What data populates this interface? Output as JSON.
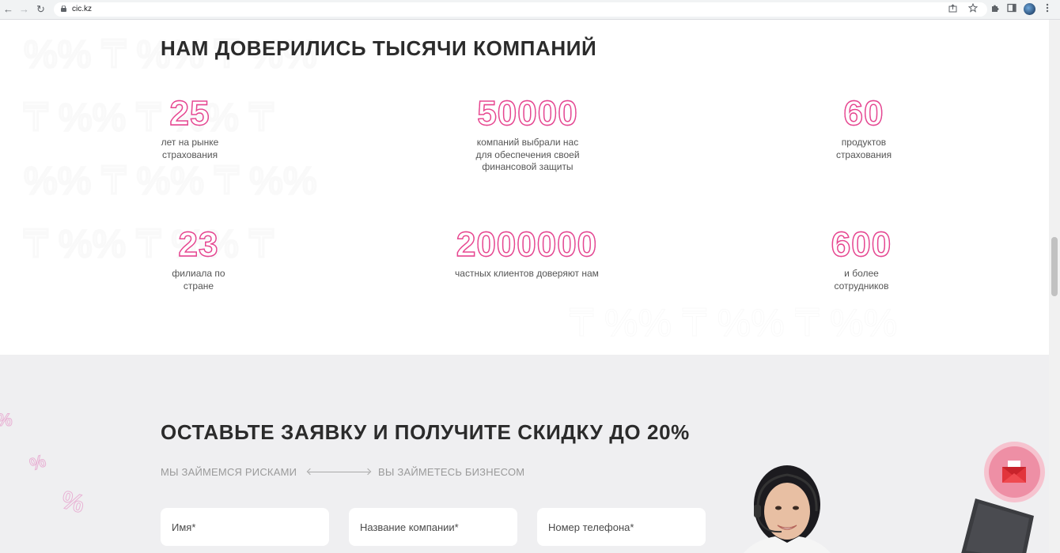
{
  "browser": {
    "url": "cic.kz",
    "back_icon": "←",
    "forward_icon": "→",
    "reload_icon": "↻"
  },
  "stats": {
    "title": "НАМ ДОВЕРИЛИСЬ ТЫСЯЧИ КОМПАНИЙ",
    "items": [
      {
        "number": "25",
        "label_lines": [
          "лет на рынке",
          "страхования"
        ]
      },
      {
        "number": "50000",
        "label_lines": [
          "компаний выбрали нас",
          "для обеспечения своей",
          "финансовой защиты"
        ]
      },
      {
        "number": "60",
        "label_lines": [
          "продуктов",
          "страхования"
        ]
      },
      {
        "number": "23",
        "label_lines": [
          "филиала по",
          "стране"
        ]
      },
      {
        "number": "2000000",
        "label_lines": [
          "частных клиентов доверяют нам"
        ]
      },
      {
        "number": "600",
        "label_lines": [
          "и более",
          "сотрудников"
        ]
      }
    ]
  },
  "form": {
    "title": "ОСТАВЬТЕ ЗАЯВКУ И ПОЛУЧИТЕ СКИДКУ ДО 20%",
    "tagline_left": "МЫ ЗАЙМЕМСЯ РИСКАМИ",
    "tagline_right": "ВЫ ЗАЙМЕТЕСЬ БИЗНЕСОМ",
    "fields": [
      {
        "placeholder": "Имя*"
      },
      {
        "placeholder": "Название компании*"
      },
      {
        "placeholder": "Номер телефона*"
      }
    ]
  },
  "colors": {
    "accent_pink": "#e8468f",
    "accent_purple": "#6c4fd6",
    "chat_button": "#ee8fa5"
  }
}
